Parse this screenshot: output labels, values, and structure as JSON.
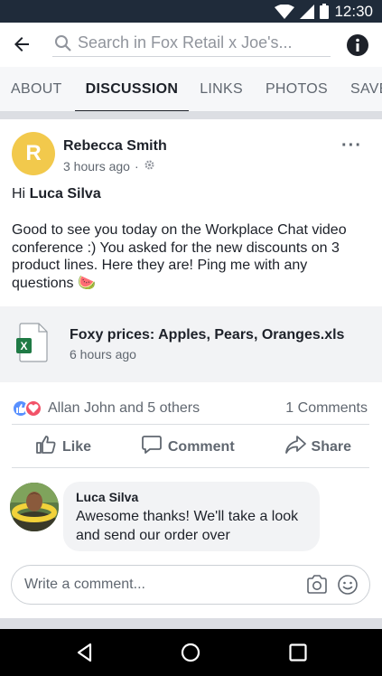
{
  "status_bar": {
    "time": "12:30"
  },
  "search": {
    "placeholder": "Search in Fox Retail x Joe's..."
  },
  "tabs": [
    {
      "label": "ABOUT"
    },
    {
      "label": "DISCUSSION"
    },
    {
      "label": "LINKS"
    },
    {
      "label": "PHOTOS"
    },
    {
      "label": "SAVED"
    }
  ],
  "post": {
    "avatar_letter": "R",
    "author": "Rebecca Smith",
    "time": "3 hours ago",
    "greeting_prefix": "Hi ",
    "greeting_name": "Luca Silva",
    "body": "Good to see you today on the Workplace Chat video conference :) You asked for the new discounts on 3 product lines. Here they are! Ping me with any questions 🍉",
    "attachment": {
      "title": "Foxy prices: Apples, Pears, Oranges.xls",
      "time": "6 hours ago"
    },
    "reactions_text": "Allan John and 5 others",
    "comments_count": "1 Comments",
    "actions": {
      "like": "Like",
      "comment": "Comment",
      "share": "Share"
    }
  },
  "comment": {
    "author": "Luca Silva",
    "text": "Awesome thanks! We'll take a look and send our order over"
  },
  "composer": {
    "placeholder": "Write a comment..."
  },
  "colors": {
    "avatar": "#f2c94c",
    "excel_green": "#1f7a45",
    "like_blue": "#5890ff",
    "love_red": "#f25268"
  }
}
